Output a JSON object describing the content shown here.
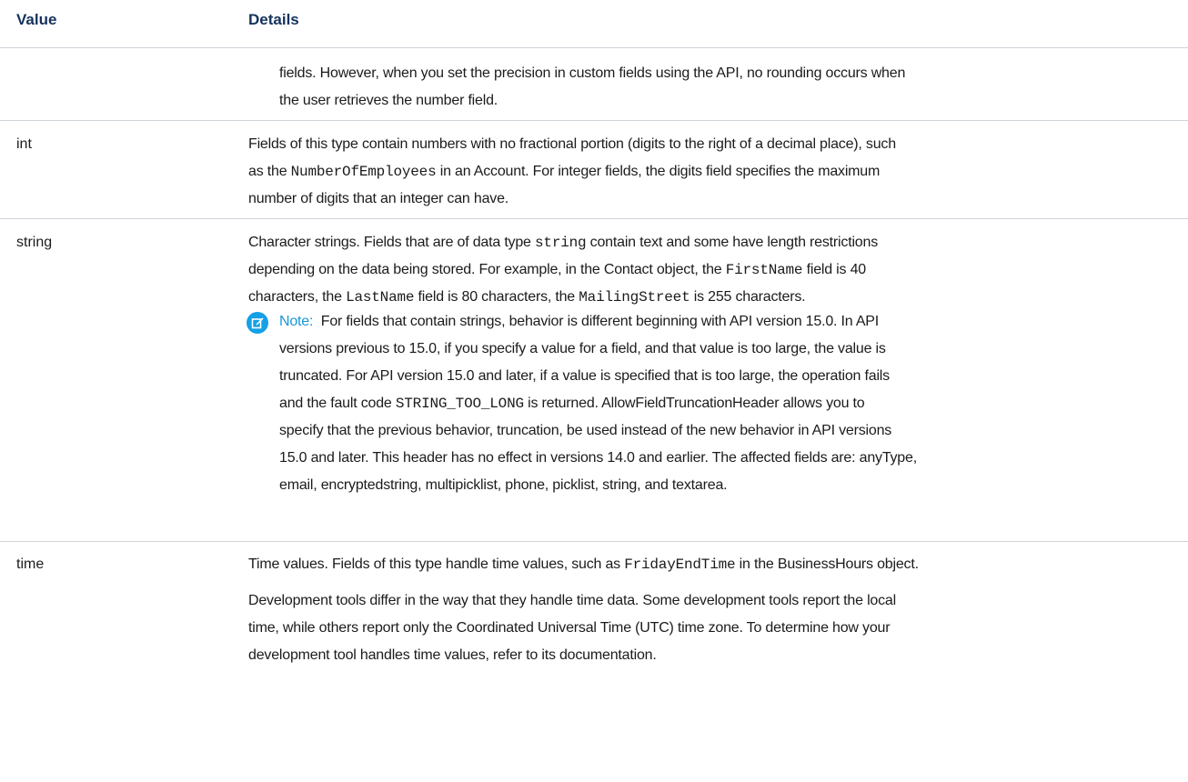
{
  "table": {
    "headers": {
      "value": "Value",
      "details": "Details"
    },
    "continued": {
      "text1": "fields. However, when you set the precision in custom fields using the API, no rounding occurs when",
      "text2": "the user retrieves the number field."
    },
    "int_row": {
      "value": "int",
      "l1": "Fields of this type contain numbers with no fractional portion (digits to the right of a decimal place), such",
      "l2a": "as the ",
      "l2code": "NumberOfEmployees",
      "l2b": " in an Account. For integer fields, the digits field specifies the maximum",
      "l3": "number of digits that an integer can have."
    },
    "string_row": {
      "value": "string",
      "l1a": "Character strings. Fields that are of data type ",
      "l1code": "string",
      "l1b": " contain text and some have length restrictions",
      "l2a": "depending on the data being stored. For example, in the Contact object, the ",
      "l2code": "FirstName",
      "l2b": " field is 40",
      "l3a": "characters, the ",
      "l3code1": "LastName",
      "l3b": " field is 80 characters, the ",
      "l3code2": "MailingStreet",
      "l3c": " is 255 characters.",
      "note": {
        "icon": "edit-note-icon",
        "label": "Note:",
        "l1": "  For fields that contain strings, behavior is different beginning with API version 15.0. In API",
        "l2": "versions previous to 15.0, if you specify a value for a field, and that value is too large, the value is",
        "l3": "truncated. For API version 15.0 and later, if a value is specified that is too large, the operation fails",
        "l4a": "and the fault code ",
        "l4code": "STRING_TOO_LONG",
        "l4b": " is returned. AllowFieldTruncationHeader allows you to",
        "l5": "specify that the previous behavior, truncation, be used instead of the new behavior in API versions",
        "l6": "15.0 and later. This header has no effect in versions 14.0 and earlier. The affected fields are: anyType,",
        "l7": "email, encryptedstring, multipicklist, phone, picklist, string, and textarea."
      }
    },
    "time_row": {
      "value": "time",
      "l1a": "Time values. Fields of this type handle time values, such as ",
      "l1code": "FridayEndTime",
      "l1b": " in the BusinessHours object.",
      "p2l1": "Development tools differ in the way that they handle time data. Some development tools report the local",
      "p2l2": "time, while others report only the Coordinated Universal Time (UTC) time zone. To determine how your",
      "p2l3": "development tool handles time values, refer to its documentation."
    }
  },
  "colors": {
    "accent": "#13a0e6",
    "header": "#16325c",
    "divider": "#cfd4da"
  }
}
